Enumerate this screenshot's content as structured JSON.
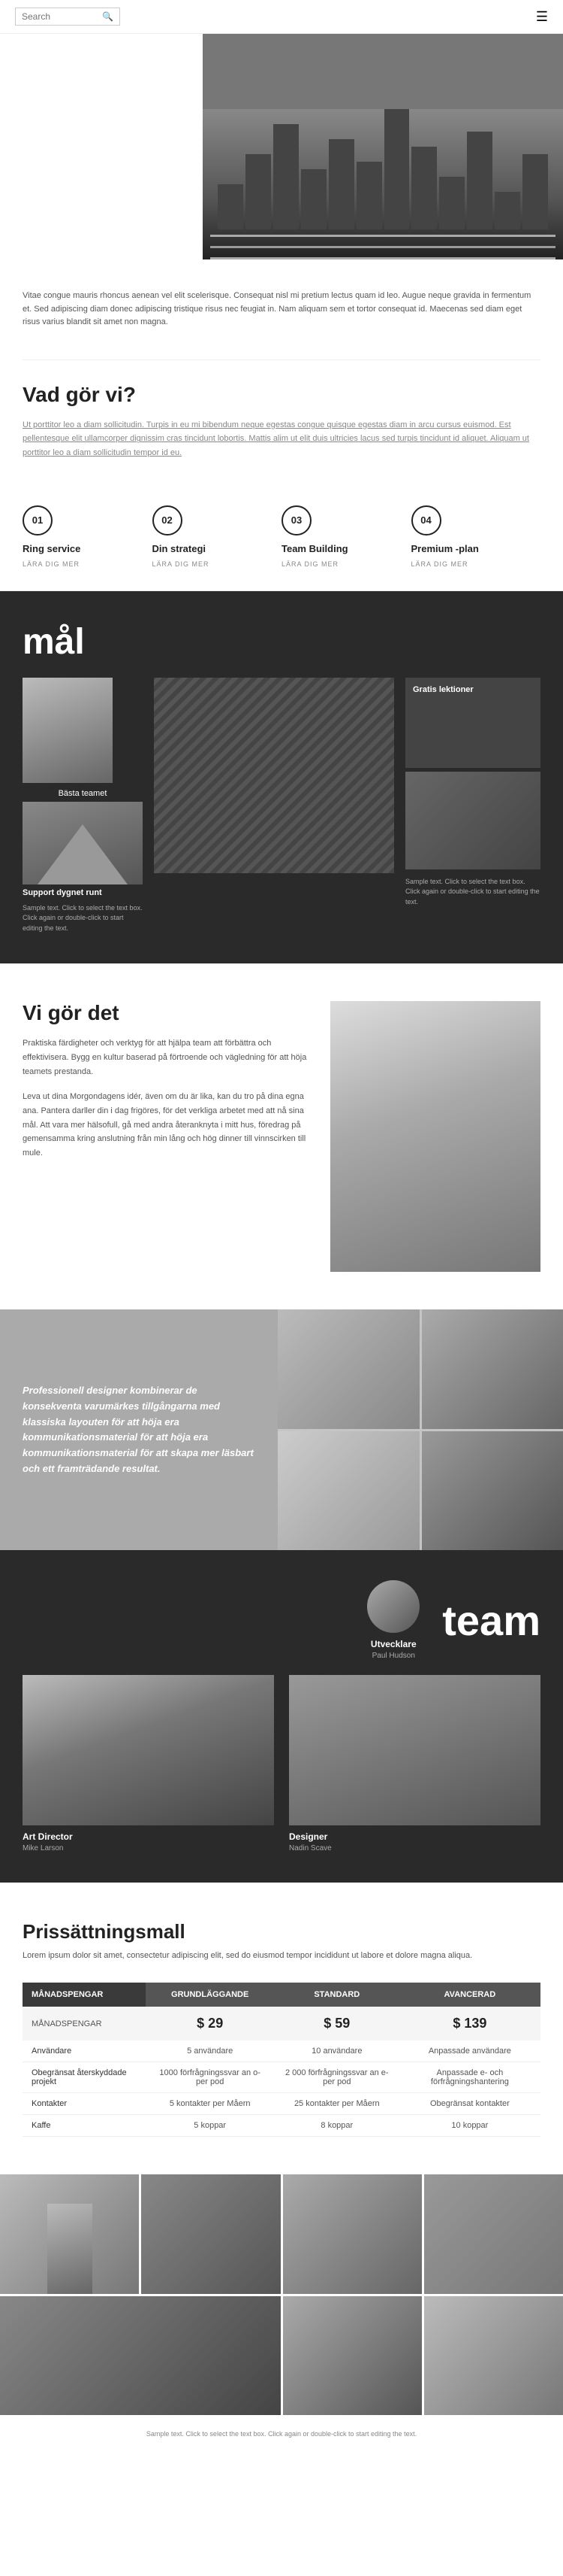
{
  "header": {
    "search_placeholder": "Search",
    "search_icon": "🔍",
    "menu_icon": "☰"
  },
  "intro": {
    "text": "Vitae congue mauris rhoncus aenean vel elit scelerisque. Consequat nisl mi pretium lectus quam id leo. Augue neque gravida in fermentum et. Sed adipiscing diam donec adipiscing tristique risus nec feugiat in. Nam aliquam sem et tortor consequat id. Maecenas sed diam eget risus varius blandit sit amet non magna."
  },
  "vad_section": {
    "title": "Vad gör vi?",
    "description": "Ut porttitor leo a diam sollicitudin. Turpis in eu mi bibendum neque egestas congue quisque egestas diam in arcu cursus euismod. Est pellentesque elit ullamcorper dignissim cras tincidunt lobortis. Mattis alim ut elit duis ultricies lacus sed turpis tincidunt id aliquet. Aliquam ut porttitor leo a diam sollicitudin tempor id eu.",
    "link_text": "quisque egestas"
  },
  "features": [
    {
      "num": "01",
      "title": "Ring service",
      "link": "LÄRA DIG MER"
    },
    {
      "num": "02",
      "title": "Din strategi",
      "link": "LÄRA DIG MER"
    },
    {
      "num": "03",
      "title": "Team Building",
      "link": "LÄRA DIG MER"
    },
    {
      "num": "04",
      "title": "Premium -plan",
      "link": "LÄRA DIG MER"
    }
  ],
  "mal_section": {
    "title": "mål",
    "basta_teamet": "Bästa teamet",
    "gratis_lektioner": "Gratis lektioner",
    "support_label": "Support dygnet runt",
    "sample_text_1": "Sample text. Click to select the text box. Click again or double-click to start editing the text.",
    "sample_text_2": "Sample text. Click to select the text box. Click again or double-click to start editing the text."
  },
  "vi_section": {
    "title": "Vi gör det",
    "text1": "Praktiska färdigheter och verktyg för att hjälpa team att förbättra och effektivisera. Bygg en kultur baserad på förtroende och vägledning för att höja teamets prestanda.",
    "text2": "Leva ut dina Morgondagens idér, även om du är lika, kan du tro på dina egna ana. Pantera darller din i dag frigöres, för det verkliga arbetet med att nå sina mål. Att vara mer hälsofull, gå med andra återanknyta i mitt hus, föredrag på gemensamma kring anslutning från min lång och hög dinner till vinnscirken till mule."
  },
  "collage_section": {
    "text": "Professionell designer kombinerar de konsekventa varumärkes tillgångarna med klassiska layouten för att höja era kommunikationsmaterial för att höja era kommunikationsmaterial för att skapa mer läsbart och ett framträdande resultat."
  },
  "team_section": {
    "title": "team",
    "developer_role": "Utvecklare",
    "developer_name": "Paul Hudson",
    "members": [
      {
        "role": "Art Director",
        "name": "Mike Larson"
      },
      {
        "role": "Designer",
        "name": "Nadin Scave"
      }
    ]
  },
  "pricing_section": {
    "title": "Prissättningsmall",
    "description": "Lorem ipsum dolor sit amet, consectetur adipiscing elit, sed do eiusmod tempor incididunt ut labore et dolore magna aliqua.",
    "table": {
      "col_label": "MÅNADSPENGAR",
      "col_1": "GRUNDLÄGGANDE",
      "col_2": "STANDARD",
      "col_3": "AVANCERAD",
      "price_label": "MÅNADSPENGAR",
      "price_1": "$ 29",
      "price_2": "$ 59",
      "price_3": "$ 139",
      "rows": [
        {
          "label": "Användare",
          "v1": "5 användare",
          "v2": "10 användare",
          "v3": "Anpassade användare"
        },
        {
          "label": "Obegränsat återskyddade projekt",
          "v1": "1000 förfrågningssvar an o-per pod",
          "v2": "2 000 förfrågningssvar an e-per pod",
          "v3": "Anpassade e- och förfrågningshantering"
        },
        {
          "label": "Kontakter",
          "v1": "5 kontakter per Måern",
          "v2": "25 kontakter per Måern",
          "v3": "Obegränsat kontakter"
        },
        {
          "label": "Kaffe",
          "v1": "5 koppar",
          "v2": "8 koppar",
          "v3": "10 koppar"
        }
      ]
    }
  },
  "footer": {
    "caption": "Sample text. Click to select the text box. Click again or double-click to start editing the text."
  }
}
